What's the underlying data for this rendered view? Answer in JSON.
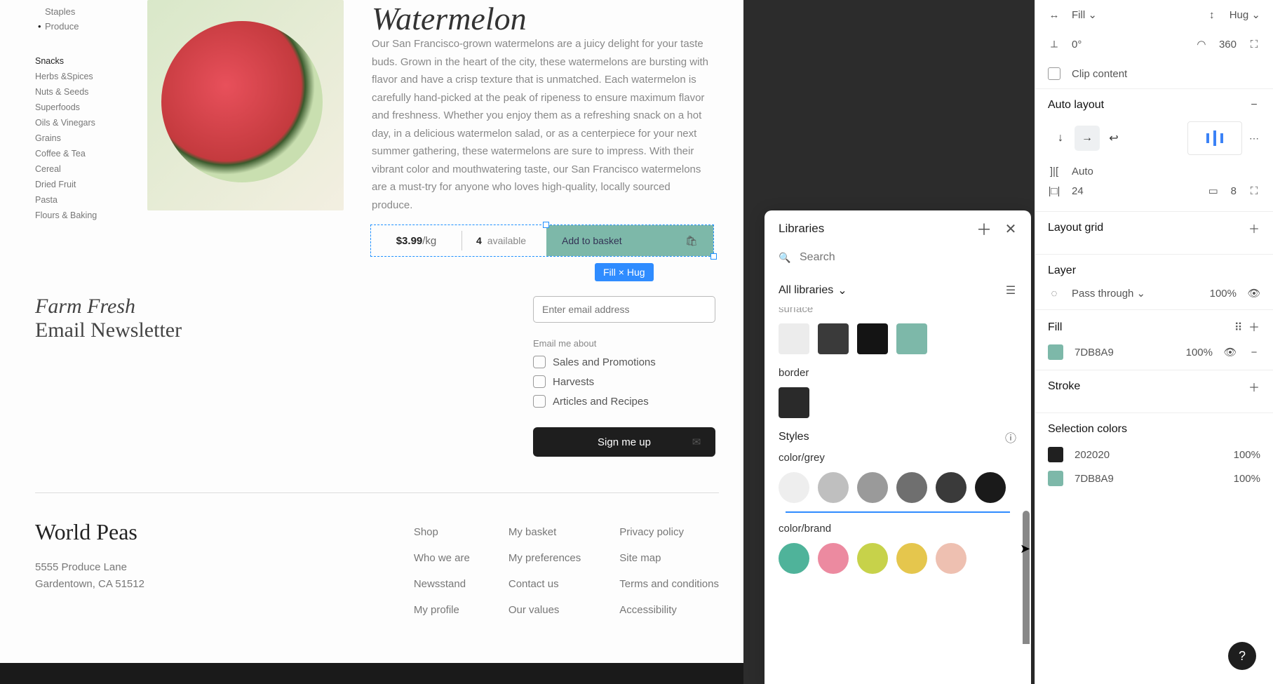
{
  "canvas": {
    "nav": {
      "top": [
        {
          "label": "Staples",
          "dot": false
        },
        {
          "label": "Produce",
          "dot": true
        }
      ],
      "snacksHeader": "Snacks",
      "snacks": [
        "Herbs &Spices",
        "Nuts & Seeds",
        "Superfoods",
        "Oils & Vinegars",
        "Grains",
        "Coffee & Tea",
        "Cereal",
        "Dried Fruit",
        "Pasta",
        "Flours & Baking"
      ]
    },
    "product": {
      "title": "Watermelon",
      "description": "Our San Francisco-grown watermelons are a juicy delight for your taste buds. Grown in the heart of the city, these watermelons are bursting with flavor and have a crisp texture that is unmatched. Each watermelon is carefully hand-picked at the peak of ripeness to ensure maximum flavor and freshness. Whether you enjoy them as a refreshing snack on a hot day, in a delicious watermelon salad, or as a centerpiece for your next summer gathering, these watermelons are sure to impress. With their vibrant color and mouthwatering taste, our San Francisco watermelons are a must-try for anyone who loves high-quality, locally sourced produce.",
      "price": "$3.99",
      "priceUnit": "/kg",
      "qty": "4",
      "avail": "available",
      "cta": "Add to basket"
    },
    "selBadge": "Fill × Hug",
    "newsletter": {
      "line1": "Farm Fresh",
      "line2": "Email Newsletter",
      "placeholder": "Enter email address",
      "aboutLabel": "Email me about",
      "opts": [
        "Sales and Promotions",
        "Harvests",
        "Articles and Recipes"
      ],
      "signup": "Sign me up"
    },
    "footer": {
      "brand": "World Peas",
      "addr1": "5555 Produce Lane",
      "addr2": "Gardentown, CA 51512",
      "cols": [
        [
          "Shop",
          "Who we are",
          "Newsstand",
          "My profile"
        ],
        [
          "My basket",
          "My preferences",
          "Contact us",
          "Our values"
        ],
        [
          "Privacy policy",
          "Site map",
          "Terms and conditions",
          "Accessibility"
        ]
      ]
    }
  },
  "libraries": {
    "title": "Libraries",
    "searchPlaceholder": "Search",
    "allLabel": "All libraries",
    "groups": {
      "surface": {
        "label": "surface",
        "swatches": [
          "#ececec",
          "#3a3a3a",
          "#141414",
          "#7db8a9"
        ]
      },
      "border": {
        "label": "border",
        "swatches": [
          "#2a2a2a"
        ]
      }
    },
    "stylesLabel": "Styles",
    "colorGrey": {
      "label": "color/grey",
      "swatches": [
        "#eeeeee",
        "#bfbfbf",
        "#9a9a9a",
        "#6f6f6f",
        "#3a3a3a",
        "#1a1a1a"
      ]
    },
    "colorBrand": {
      "label": "color/brand",
      "swatches": [
        "#4fb39a",
        "#ec8aa0",
        "#c7d24a",
        "#e5c64d",
        "#eec0b1"
      ]
    }
  },
  "inspector": {
    "resizeH": "Fill",
    "resizeV": "Hug",
    "rotate": "0°",
    "corner": "360",
    "clip": "Clip content",
    "autoLayout": {
      "title": "Auto layout",
      "spacing": "Auto",
      "padH": "24",
      "padV": "8"
    },
    "layoutGrid": "Layout grid",
    "layer": {
      "title": "Layer",
      "blend": "Pass through",
      "opacity": "100%"
    },
    "fill": {
      "title": "Fill",
      "hex": "7DB8A9",
      "opacity": "100%"
    },
    "stroke": {
      "title": "Stroke"
    },
    "selColors": {
      "title": "Selection colors",
      "rows": [
        {
          "hex": "202020",
          "op": "100%",
          "color": "#202020"
        },
        {
          "hex": "7DB8A9",
          "op": "100%",
          "color": "#7db8a9"
        }
      ]
    }
  }
}
